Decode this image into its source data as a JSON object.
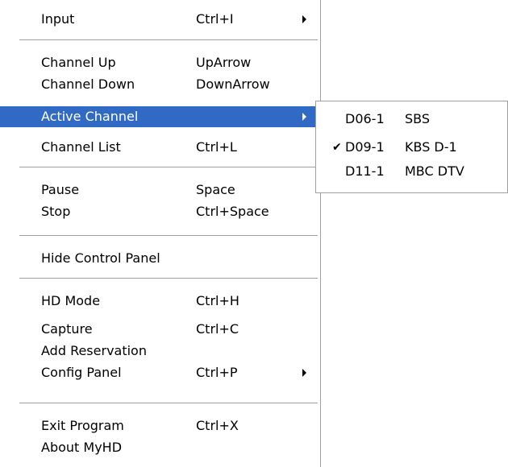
{
  "menu": {
    "input": {
      "label": "Input",
      "shortcut": "Ctrl+I"
    },
    "channel_up": {
      "label": "Channel Up",
      "shortcut": "UpArrow"
    },
    "channel_down": {
      "label": "Channel Down",
      "shortcut": "DownArrow"
    },
    "active_channel": {
      "label": "Active Channel"
    },
    "channel_list": {
      "label": "Channel List",
      "shortcut": "Ctrl+L"
    },
    "pause": {
      "label": "Pause",
      "shortcut": "Space"
    },
    "stop": {
      "label": "Stop",
      "shortcut": "Ctrl+Space"
    },
    "hide_control_panel": {
      "label": "Hide Control Panel"
    },
    "hd_mode": {
      "label": "HD Mode",
      "shortcut": "Ctrl+H"
    },
    "capture": {
      "label": "Capture",
      "shortcut": "Ctrl+C"
    },
    "add_reservation": {
      "label": "Add Reservation"
    },
    "config_panel": {
      "label": "Config Panel",
      "shortcut": "Ctrl+P"
    },
    "exit_program": {
      "label": "Exit Program",
      "shortcut": "Ctrl+X"
    },
    "about": {
      "label": "About MyHD"
    }
  },
  "submenu": {
    "items": [
      {
        "code": "D06-1",
        "name": "SBS",
        "checked": false
      },
      {
        "code": "D09-1",
        "name": "KBS D-1",
        "checked": true
      },
      {
        "code": "D11-1",
        "name": "MBC DTV",
        "checked": false
      }
    ],
    "check_glyph": "✔"
  },
  "colors": {
    "highlight": "#316ac5",
    "separator": "#a0a0a0"
  }
}
